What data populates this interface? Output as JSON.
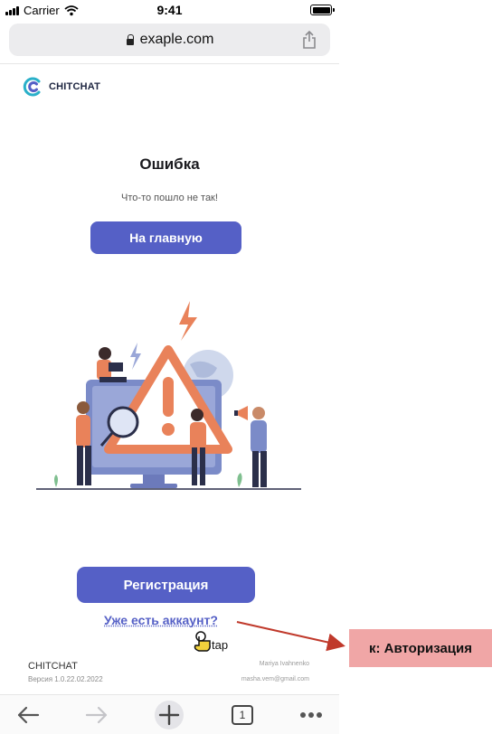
{
  "status_bar": {
    "carrier": "Carrier",
    "time": "9:41"
  },
  "browser": {
    "url": "exaple.com"
  },
  "logo": {
    "name": "CHITCHAT"
  },
  "error": {
    "title": "Ошибка",
    "message": "Что-то пошло не так!",
    "home_button": "На главную"
  },
  "auth": {
    "register_button": "Регистрация",
    "have_account_link": "Уже есть аккаунт?",
    "tap_label": "tap"
  },
  "footer": {
    "brand": "CHITCHAT",
    "version": "Версия 1.0.22.02.2022",
    "author": "Mariya Ivahnenko",
    "email": "masha.vem@gmail.com"
  },
  "toolbar": {
    "tabs_count": "1"
  },
  "annotation": {
    "label": "к: Авторизация"
  },
  "colors": {
    "accent": "#5560c6",
    "annotation": "#f0a6a6",
    "arrow": "#c0392b",
    "warning": "#e9825a"
  }
}
